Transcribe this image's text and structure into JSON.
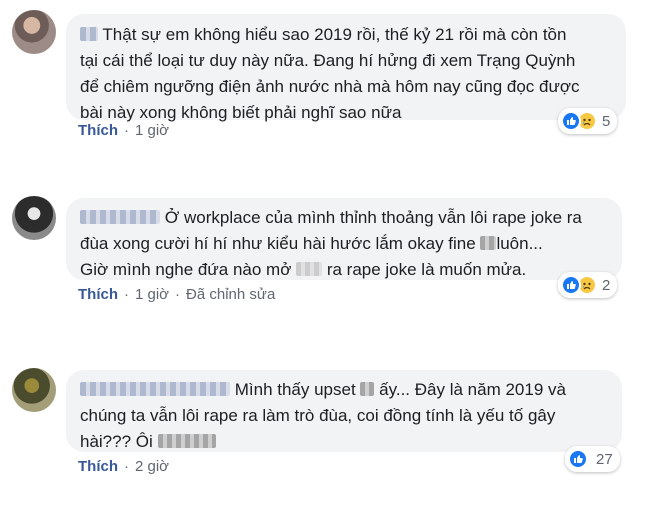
{
  "comments": [
    {
      "text": "Thật sự em không hiểu sao 2019 rồi, thế kỷ 21 rồi mà còn tồn tại cái thể loại tư duy này nữa. Đang hí hửng đi xem Trạng Quỳnh để chiêm ngưỡng điện ảnh nước nhà mà hôm nay cũng đọc được bài này xong không biết phải nghĩ sao nữa",
      "lines": [
        "Thật sự em không hiểu sao 2019 rồi, thế kỷ 21 rồi mà còn tồn",
        "tại cái thể loại tư duy này nữa. Đang hí hửng đi xem Trạng Quỳnh",
        "để chiêm ngưỡng điện ảnh nước nhà mà hôm nay cũng đọc được",
        "bài này xong không biết phải nghĩ sao nữa"
      ],
      "like_label": "Thích",
      "time": "1 giờ",
      "edited": "",
      "reaction_icons": [
        "like-icon",
        "sad-icon"
      ],
      "reaction_count": "5"
    },
    {
      "lines_parts": {
        "line1": "Ở workplace của mình thỉnh thoảng vẫn lôi rape joke ra",
        "line2a": "đùa xong cười hí hí như kiểu hài hước lắm okay fine",
        "line2b": "luôn...",
        "line3a": "Giờ mình nghe đứa nào mở",
        "line3b": "ra rape joke là muốn mửa."
      },
      "like_label": "Thích",
      "time": "1 giờ",
      "edited": "Đã chỉnh sửa",
      "reaction_icons": [
        "like-icon",
        "sad-icon"
      ],
      "reaction_count": "2"
    },
    {
      "lines_parts": {
        "line1a": "Mình thấy upset",
        "line1b": "ấy... Đây là năm 2019 và",
        "line2": "chúng ta vẫn lôi rape ra làm trò đùa, coi đồng tính là yếu tố gây",
        "line3": "hài??? Ôi"
      },
      "like_label": "Thích",
      "time": "2 giờ",
      "edited": "",
      "reaction_icons": [
        "like-icon"
      ],
      "reaction_count": "27"
    }
  ],
  "separator": "·",
  "colors": {
    "bubble": "#f2f3f5",
    "link": "#385898",
    "meta": "#606770",
    "like_blue": "#1877f2",
    "sad_yellow": "#f7c843"
  }
}
